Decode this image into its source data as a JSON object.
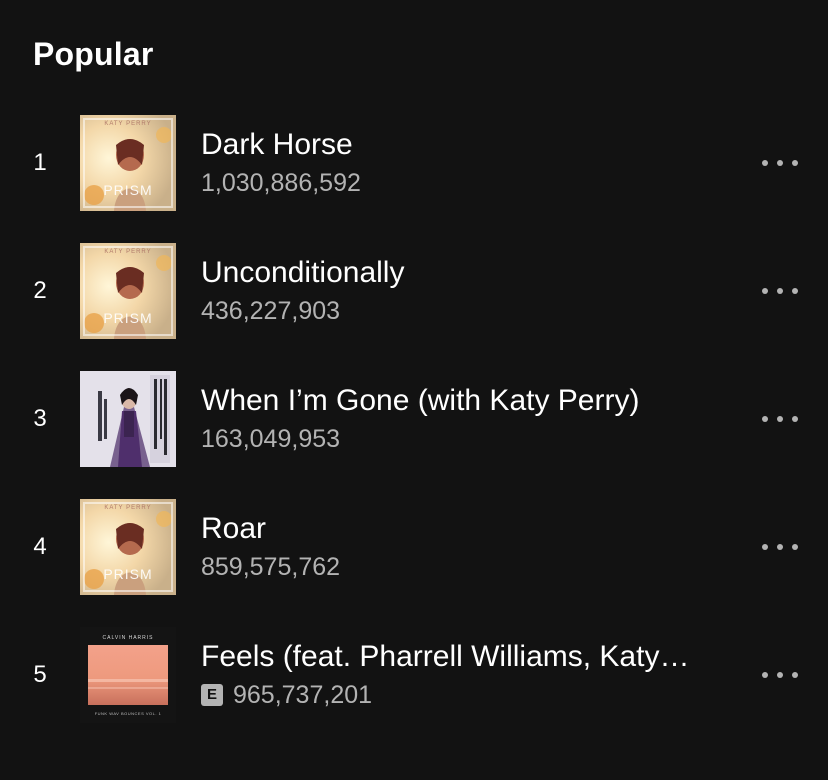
{
  "section": {
    "title": "Popular"
  },
  "tracks": [
    {
      "index": "1",
      "title": "Dark Horse",
      "plays": "1,030,886,592",
      "explicit": false,
      "cover": "prism-cover",
      "cover_artist_text": "KATY PERRY",
      "cover_album_text": "PRISM"
    },
    {
      "index": "2",
      "title": "Unconditionally",
      "plays": "436,227,903",
      "explicit": false,
      "cover": "prism-cover",
      "cover_artist_text": "KATY PERRY",
      "cover_album_text": "PRISM"
    },
    {
      "index": "3",
      "title": "When I’m Gone (with Katy Perry)",
      "plays": "163,049,953",
      "explicit": false,
      "cover": "when-im-gone-cover"
    },
    {
      "index": "4",
      "title": "Roar",
      "plays": "859,575,762",
      "explicit": false,
      "cover": "prism-cover",
      "cover_artist_text": "KATY PERRY",
      "cover_album_text": "PRISM"
    },
    {
      "index": "5",
      "title": "Feels (feat. Pharrell Williams, Katy…",
      "plays": "965,737,201",
      "explicit": true,
      "explicit_label": "E",
      "cover": "funk-wav-cover",
      "cover_artist_text": "CALVIN HARRIS",
      "cover_album_text": "FUNK WAV BOUNCES VOL. 1"
    }
  ],
  "colors": {
    "background": "#121212",
    "primary_text": "#ffffff",
    "secondary_text": "#b3b3b3"
  },
  "icons": {
    "more": "more-options-icon"
  }
}
